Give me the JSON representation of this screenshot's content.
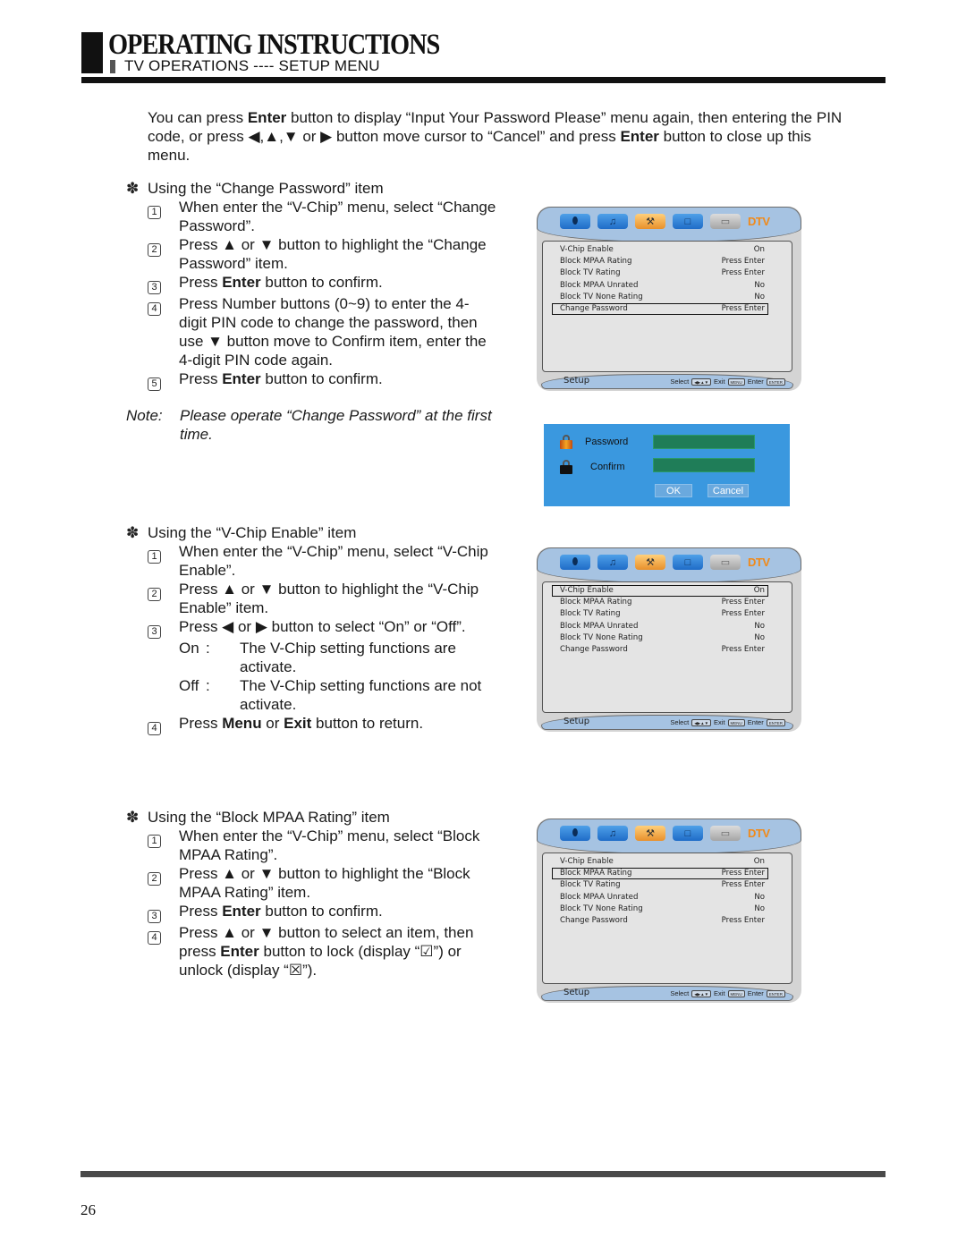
{
  "header": {
    "title": "OPERATING INSTRUCTIONS",
    "subtitle": "TV OPERATIONS ---- SETUP MENU"
  },
  "intro": {
    "parts": [
      "You can press ",
      "Enter",
      " button to display “Input Your Password Please” menu again, then entering the PIN code, or press ◀,▲,▼ or ▶ button move cursor to “Cancel” and press ",
      "Enter",
      " button to close up this menu."
    ]
  },
  "section_change_password": {
    "title": "Using the “Change Password” item",
    "steps": [
      {
        "n": "1",
        "text": "When enter the “V-Chip” menu, select “Change Password”."
      },
      {
        "n": "2",
        "text": "Press ▲ or ▼ button to highlight the “Change Password” item."
      },
      {
        "n": "3",
        "pre": "Press ",
        "bold": "Enter",
        "post": " button to confirm."
      },
      {
        "n": "4",
        "text": "Press Number buttons (0~9) to enter the 4-digit PIN code to change the password, then use ▼ button move to Confirm item, enter the 4-digit PIN code again."
      },
      {
        "n": "5",
        "pre": "Press ",
        "bold": "Enter",
        "post": " button to confirm."
      }
    ],
    "note_label": "Note:",
    "note_text": "Please operate “Change Password” at the first time."
  },
  "section_vchip_enable": {
    "title": "Using the “V-Chip Enable” item",
    "steps": [
      {
        "n": "1",
        "text": "When enter the “V-Chip” menu, select “V-Chip Enable”."
      },
      {
        "n": "2",
        "text": "Press ▲ or ▼ button to highlight the “V-Chip Enable” item."
      },
      {
        "n": "3",
        "text": "Press ◀ or ▶ button to select “On” or “Off”."
      },
      {
        "n": "4",
        "pre": "Press ",
        "bold": "Menu",
        "mid": " or ",
        "bold2": "Exit",
        "post": " button to return."
      }
    ],
    "options": [
      {
        "key": "On",
        "sep": ":",
        "desc": "The V-Chip setting functions are activate."
      },
      {
        "key": "Off",
        "sep": ":",
        "desc": "The V-Chip setting functions are not activate."
      }
    ]
  },
  "section_block_mpaa": {
    "title": "Using the “Block MPAA Rating” item",
    "steps": [
      {
        "n": "1",
        "text": "When enter the “V-Chip” menu, select “Block MPAA Rating”."
      },
      {
        "n": "2",
        "text": "Press ▲ or ▼ button to highlight the “Block MPAA Rating” item."
      },
      {
        "n": "3",
        "pre": "Press ",
        "bold": "Enter",
        "post": " button to confirm."
      },
      {
        "n": "4",
        "pre": "Press ▲ or ▼ button to select an item, then press ",
        "bold": "Enter",
        "post": " button to lock (display “☑”) or unlock (display “☒”)."
      }
    ]
  },
  "osd": {
    "tab_icons": [
      "picture-icon",
      "audio-icon",
      "setup-icon",
      "tv-icon",
      "pc-icon",
      "dtv-logo"
    ],
    "tab_glyphs": [
      "⬮",
      "♫",
      "⚒",
      "□",
      "▭",
      "DTV"
    ],
    "menu_rows": [
      {
        "label": "V-Chip Enable",
        "value": "On"
      },
      {
        "label": "Block MPAA Rating",
        "value": "Press Enter"
      },
      {
        "label": "Block TV Rating",
        "value": "Press Enter"
      },
      {
        "label": "Block MPAA Unrated",
        "value": "No"
      },
      {
        "label": "Block TV None Rating",
        "value": "No"
      },
      {
        "label": "Change Password",
        "value": "Press Enter"
      }
    ],
    "footer_title": "Setup",
    "hint_select": "Select",
    "hint_select_key": "◀▶▲▼",
    "hint_exit": "Exit",
    "hint_exit_key": "MENU",
    "hint_enter": "Enter",
    "hint_enter_key": "ENTER",
    "screens": [
      {
        "selected_row": 5
      },
      {
        "selected_row": 0
      },
      {
        "selected_row": 1
      }
    ]
  },
  "password_dialog": {
    "password_label": "Password",
    "confirm_label": "Confirm",
    "password_value": "",
    "confirm_value": "",
    "ok_label": "OK",
    "cancel_label": "Cancel",
    "colors": {
      "background": "#3a98df",
      "field": "#1f7d58",
      "lock_active": "#e8901a",
      "lock_inactive": "#111111"
    }
  },
  "footer": {
    "page_number": "26"
  }
}
